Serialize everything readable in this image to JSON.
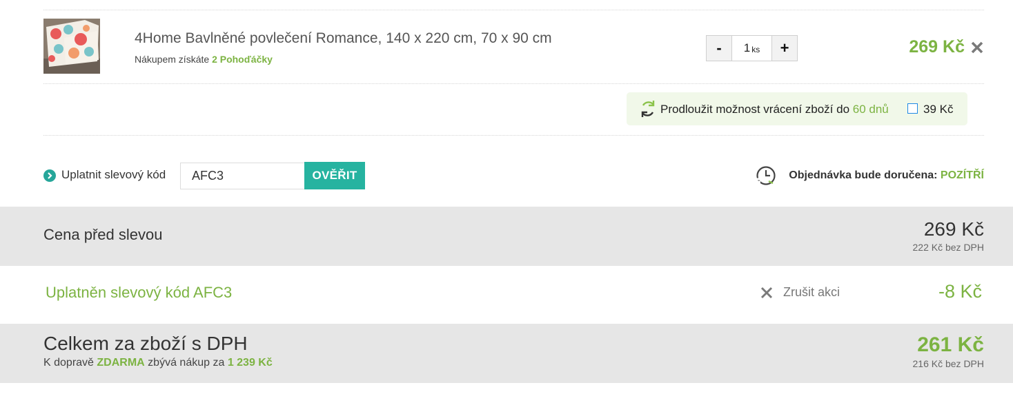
{
  "product": {
    "name": "4Home Bavlněné povlečení Romance, 140 x 220 cm, 70 x 90 cm",
    "points_prefix": "Nákupem získáte",
    "points_value": "2 Pohoďáčky",
    "qty_minus": "-",
    "qty_value": "1",
    "qty_unit": "ks",
    "qty_plus": "+",
    "price": "269 Kč",
    "remove_icon": "close-icon"
  },
  "return_ext": {
    "text": "Prodloužit možnost vrácení zboží do",
    "days": "60 dnů",
    "price": "39 Kč",
    "checked": false,
    "icon": "refresh-arrows-icon"
  },
  "coupon": {
    "label": "Uplatnit slevový kód",
    "input_value": "AFC3",
    "button": "OVĚŘIT",
    "icon": "chevron-circle-icon"
  },
  "delivery": {
    "label": "Objednávka bude doručena:",
    "value": "POZÍTŘÍ",
    "icon": "clock-icon"
  },
  "summary": {
    "before_discount_label": "Cena před slevou",
    "before_discount_price": "269 Kč",
    "before_discount_net": "222 Kč bez DPH",
    "discount_label": "Uplatněn slevový kód AFC3",
    "discount_cancel": "Zrušit akci",
    "discount_value": "-8 Kč",
    "total_label": "Celkem za zboží s DPH",
    "shipping_prefix": "K dopravě",
    "shipping_free": "ZDARMA",
    "shipping_middle": "zbývá nákup za",
    "shipping_amount": "1 239 Kč",
    "total_price": "261 Kč",
    "total_net": "216 Kč bez DPH"
  },
  "colors": {
    "accent_green": "#7cb342",
    "button_teal": "#26b3a0",
    "row_grey": "#e6e6e6",
    "return_bg": "#f1f8e9"
  }
}
